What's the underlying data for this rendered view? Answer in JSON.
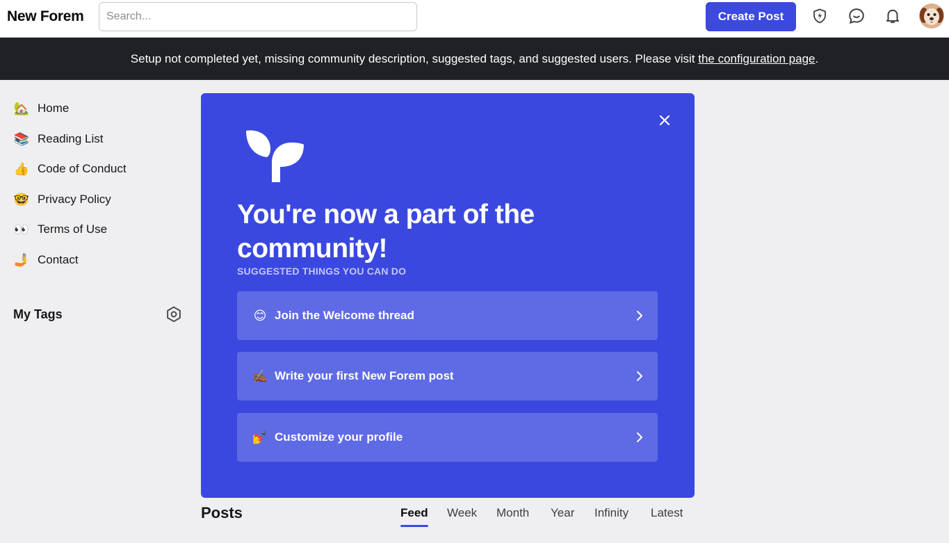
{
  "header": {
    "logo": "New Forem",
    "search_placeholder": "Search...",
    "create_post_label": "Create Post",
    "icons": [
      "moderation-shield-icon",
      "chat-icon",
      "notification-bell-icon"
    ],
    "avatar": "user-avatar-dog"
  },
  "banner": {
    "text": "Setup not completed yet, missing community description, suggested tags, and suggested users. Please visit ",
    "link_text": "the configuration page",
    "suffix": "."
  },
  "sidebar": {
    "items": [
      {
        "emoji": "🏡",
        "label": "Home"
      },
      {
        "emoji": "📚",
        "label": "Reading List"
      },
      {
        "emoji": "👍",
        "label": "Code of Conduct"
      },
      {
        "emoji": "🤓",
        "label": "Privacy Policy"
      },
      {
        "emoji": "👀",
        "label": "Terms of Use"
      },
      {
        "emoji": "🤳",
        "label": "Contact"
      }
    ],
    "my_tags_label": "My Tags"
  },
  "welcome": {
    "title": "You're now a part of the community!",
    "suggest_label": "SUGGESTED THINGS YOU CAN DO",
    "actions": [
      {
        "emoji": "😊",
        "label": "Join the Welcome thread"
      },
      {
        "emoji": "✍🏾",
        "label": "Write your first New Forem post"
      },
      {
        "emoji": "💅",
        "label": "Customize your profile"
      }
    ]
  },
  "posts": {
    "title": "Posts",
    "tabs": [
      "Feed",
      "Week",
      "Month",
      "Year",
      "Infinity",
      "Latest"
    ],
    "active_tab": "Feed"
  },
  "colors": {
    "accent": "#3b49df",
    "card_bg": "#3b48df",
    "action_bg": "#5f6ae5",
    "banner_bg": "#202124",
    "page_bg": "#efeff1"
  }
}
